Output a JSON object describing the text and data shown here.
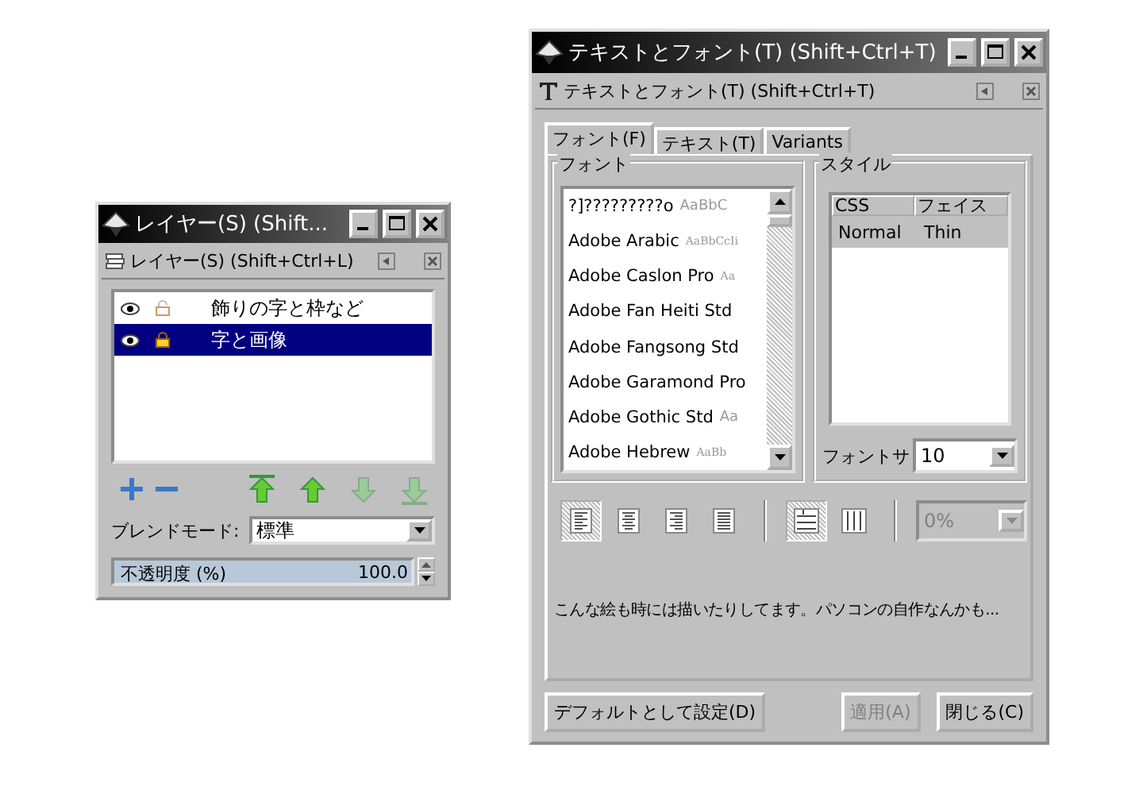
{
  "layers_window": {
    "title": "レイヤー(S) (Shift...",
    "panel_title": "レイヤー(S) (Shift+Ctrl+L)",
    "layers": [
      {
        "name": "飾りの字と枠など",
        "visible": true,
        "locked": false,
        "selected": false
      },
      {
        "name": "字と画像",
        "visible": true,
        "locked": true,
        "selected": true
      }
    ],
    "tools": [
      {
        "kind": "add",
        "disabled": false
      },
      {
        "kind": "remove",
        "disabled": false
      },
      {
        "kind": "top",
        "disabled": false
      },
      {
        "kind": "up",
        "disabled": false
      },
      {
        "kind": "down",
        "disabled": true
      },
      {
        "kind": "bottom",
        "disabled": true
      }
    ],
    "blend_label": "ブレンドモード:",
    "blend_value": "標準",
    "opacity": {
      "label": "不透明度 (%)",
      "value": "100.0",
      "level": 1
    }
  },
  "text_window": {
    "title": "テキストとフォント(T) (Shift+Ctrl+T)",
    "panel_title": "テキストとフォント(T) (Shift+Ctrl+T)",
    "tabs": [
      {
        "label": "フォント(F)",
        "selected": true
      },
      {
        "label": "テキスト(T)",
        "selected": false
      },
      {
        "label": "Variants",
        "selected": false
      }
    ],
    "font_group": "フォント",
    "fonts": [
      {
        "name": "?]?????????o",
        "sample": "AaBbC",
        "serif": false
      },
      {
        "name": "Adobe Arabic",
        "sample": "AaBbCcIi",
        "serif": true
      },
      {
        "name": "Adobe Caslon Pro",
        "sample": "Aa",
        "serif": true
      },
      {
        "name": "Adobe Fan Heiti Std"
      },
      {
        "name": "Adobe Fangsong Std"
      },
      {
        "name": "Adobe Garamond Pro"
      },
      {
        "name": "Adobe Gothic Std",
        "sample": "Aa",
        "serif": false
      },
      {
        "name": "Adobe Hebrew",
        "sample": "AaBb",
        "serif": true
      }
    ],
    "style_group": "スタイル",
    "style_columns": [
      "CSS",
      "フェイス"
    ],
    "styles": [
      {
        "css": "Normal",
        "face": "Thin",
        "selected": true
      }
    ],
    "size_label": "フォントサ",
    "size_value": "10",
    "align": [
      {
        "kind": "left",
        "selected": true
      },
      {
        "kind": "center",
        "selected": false
      },
      {
        "kind": "right",
        "selected": false
      },
      {
        "kind": "justify",
        "selected": false
      }
    ],
    "orientation": [
      {
        "kind": "horizontal",
        "selected": true
      },
      {
        "kind": "vertical",
        "selected": false
      }
    ],
    "spacing": {
      "value": "0%",
      "disabled": true
    },
    "preview": "こんな絵も時には描いたりしてます。パソコンの自作なんかも...",
    "buttons": [
      {
        "label": "デフォルトとして設定(D)",
        "disabled": false
      },
      {
        "label": "適用(A)",
        "disabled": true
      },
      {
        "label": "閉じる(C)",
        "disabled": false
      }
    ]
  }
}
